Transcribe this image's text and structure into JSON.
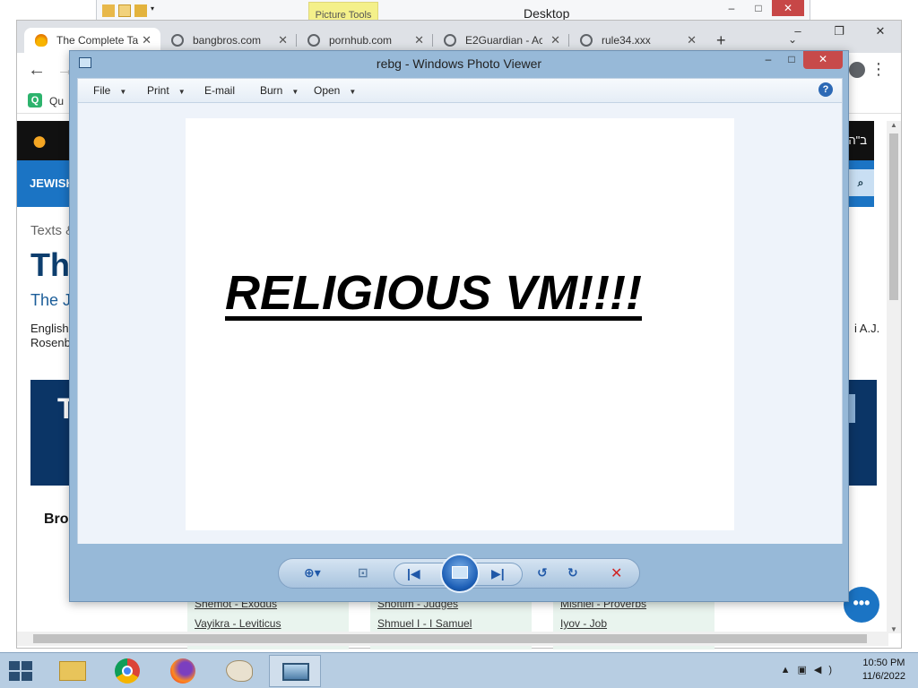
{
  "explorer": {
    "ribbon_tab": "Picture Tools",
    "title": "Desktop"
  },
  "browser": {
    "tabs": [
      {
        "label": "The Complete Ta"
      },
      {
        "label": "bangbros.com"
      },
      {
        "label": "pornhub.com"
      },
      {
        "label": "E2Guardian - Ac"
      },
      {
        "label": "rule34.xxx"
      }
    ],
    "new_tab": "+",
    "bookmark_label": "Qu",
    "page": {
      "header_right": "ב\"ה",
      "nav_label": "JEWISH",
      "texts_label": "Texts &",
      "title": "Th",
      "subtitle": "The Je",
      "body_line1": "English",
      "body_line2": "Rosenb",
      "body_right": "i A.J.",
      "banner_text": "T",
      "browse_label": "Bro",
      "books": [
        {
          "label": "Shemot - Exodus"
        },
        {
          "label": "Vayikra - Leviticus"
        },
        {
          "label": "Shoftim - Judges"
        },
        {
          "label": "Shmuel I - I Samuel"
        },
        {
          "label": "Mishlei - Proverbs"
        },
        {
          "label": "Iyov - Job"
        }
      ]
    }
  },
  "photo_viewer": {
    "title": "rebg - Windows Photo Viewer",
    "menu": {
      "file": "File",
      "print": "Print",
      "email": "E-mail",
      "burn": "Burn",
      "open": "Open"
    },
    "help": "?",
    "image_text": "RELIGIOUS VM!!!!"
  },
  "taskbar": {
    "time": "10:50 PM",
    "date": "11/6/2022"
  }
}
